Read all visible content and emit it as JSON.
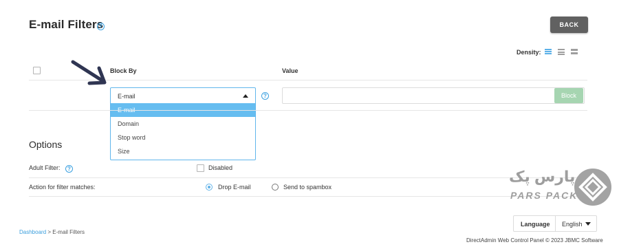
{
  "page": {
    "title": "E-mail Filters",
    "help_glyph": "?",
    "back_label": "BACK"
  },
  "density": {
    "label": "Density:",
    "active_color": "#5ab0e8",
    "inactive_color": "#9e9e9e"
  },
  "table": {
    "col_block_by": "Block By",
    "col_value": "Value"
  },
  "block_by": {
    "selected": "E-mail",
    "options": [
      "E-mail",
      "Domain",
      "Stop word",
      "Size"
    ],
    "help_glyph": "?"
  },
  "value_input": {
    "value": "",
    "placeholder": ""
  },
  "block_button": "Block",
  "options": {
    "title": "Options",
    "adult_filter_label": "Adult Filter:",
    "adult_filter_checkbox_label": "Disabled",
    "action_label": "Action for filter matches:",
    "action_drop": "Drop E-mail",
    "action_spam": "Send to spambox"
  },
  "watermark": {
    "fa_text": "پارس پک",
    "en_text": "PARS PACK"
  },
  "breadcrumb": {
    "home": "Dashboard",
    "sep": ">",
    "current": "E-mail Filters"
  },
  "language": {
    "label": "Language",
    "value": "English"
  },
  "footer": "DirectAdmin Web Control Panel © 2023 JBMC Software",
  "colors": {
    "accent": "#5ab0e8",
    "back_button": "#616161",
    "block_button": "#a6d5b1"
  }
}
